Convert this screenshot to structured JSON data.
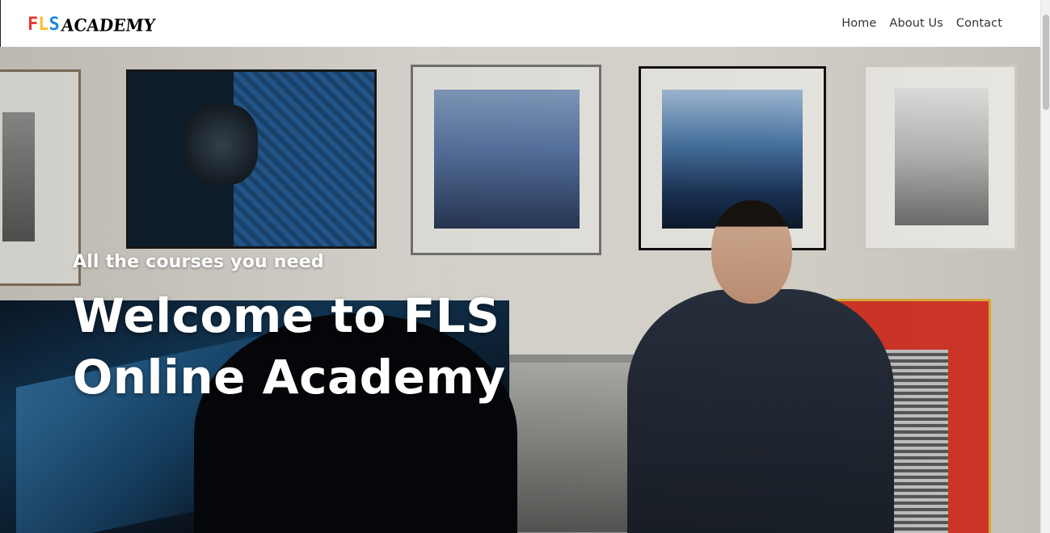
{
  "brand": {
    "logo_letters": [
      "F",
      "L",
      "S"
    ],
    "logo_letter_colors": [
      "#e53935",
      "#fbc02d",
      "#1e88e5"
    ],
    "logo_word": "ACADEMY"
  },
  "nav": {
    "items": [
      {
        "label": "Home"
      },
      {
        "label": "About Us"
      },
      {
        "label": "Contact"
      }
    ]
  },
  "hero": {
    "subtitle": "All the courses you need",
    "title": "Welcome to FLS Online Academy"
  },
  "colors": {
    "nav_text": "#333333",
    "hero_text": "#ffffff"
  }
}
